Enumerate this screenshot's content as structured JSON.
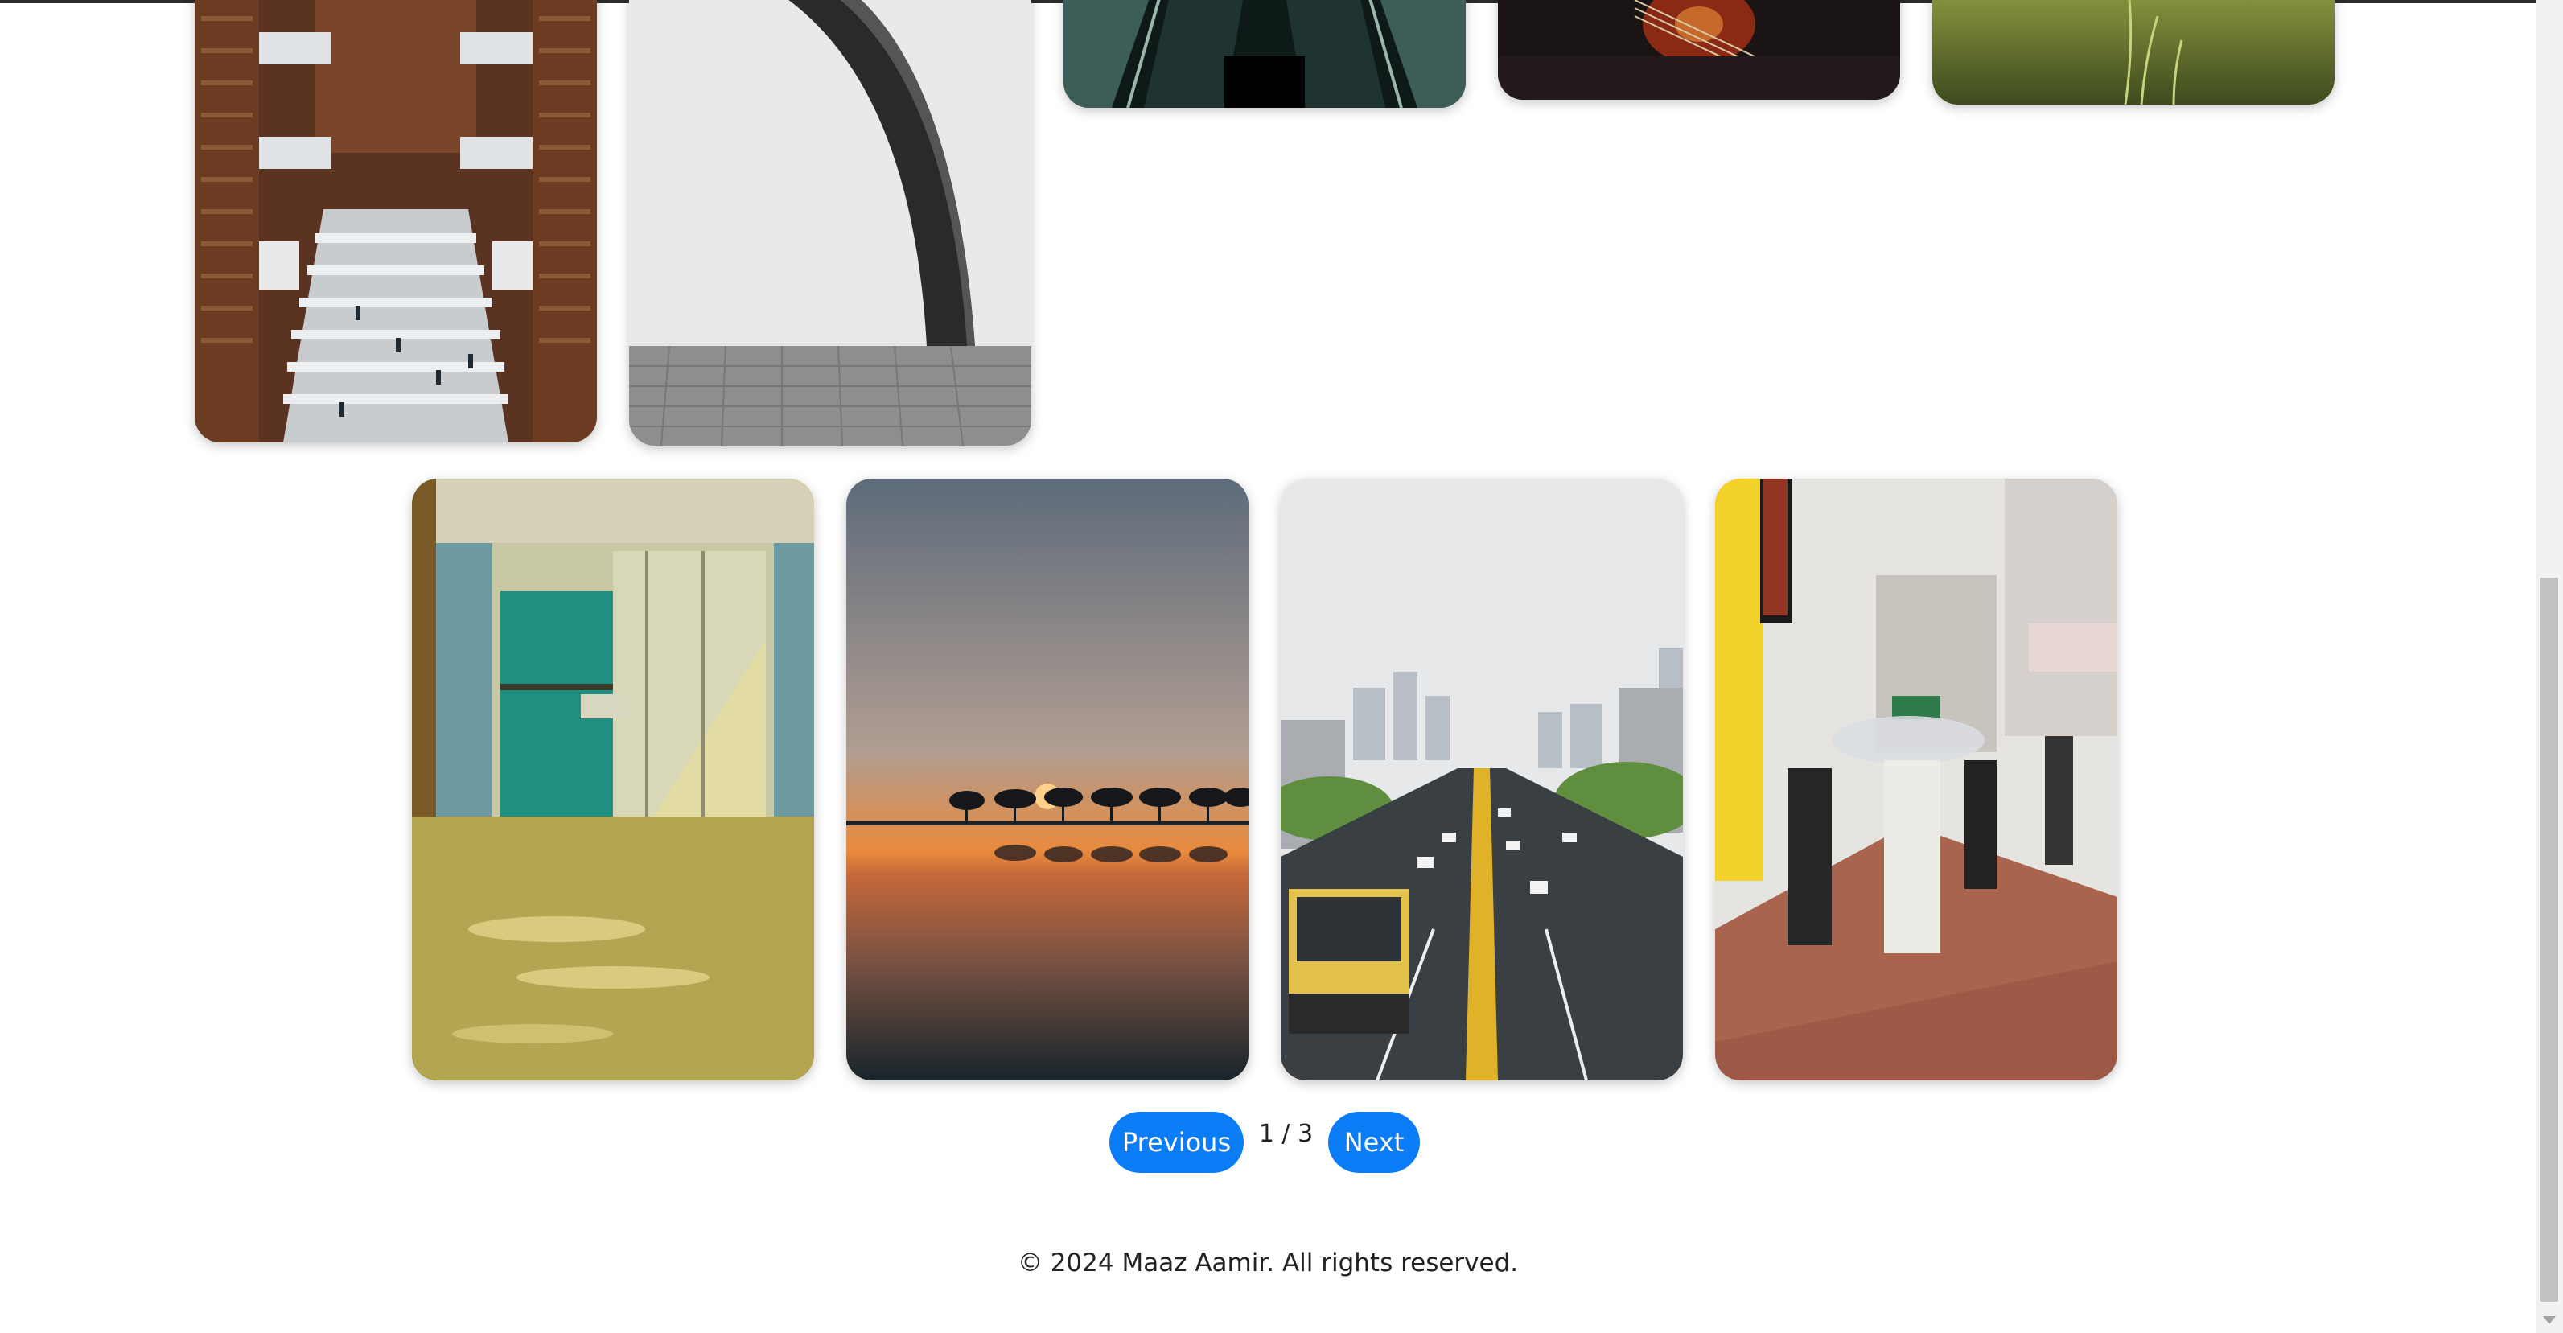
{
  "gallery": {
    "photos": [
      {
        "id": "library",
        "alt": "Library interior"
      },
      {
        "id": "arch",
        "alt": "Concrete arch"
      },
      {
        "id": "escalator",
        "alt": "Escalator"
      },
      {
        "id": "guitar",
        "alt": "Guitar"
      },
      {
        "id": "grass",
        "alt": "Grass"
      },
      {
        "id": "hallway",
        "alt": "Hallway"
      },
      {
        "id": "sunset",
        "alt": "Sunset over lake"
      },
      {
        "id": "highway",
        "alt": "City highway"
      },
      {
        "id": "street",
        "alt": "Street in rain"
      }
    ]
  },
  "pagination": {
    "previous_label": "Previous",
    "indicator": "1 / 3",
    "next_label": "Next",
    "button_color": "#0a7cf6"
  },
  "footer": {
    "text": "© 2024 Maaz Aamir. All rights reserved."
  }
}
